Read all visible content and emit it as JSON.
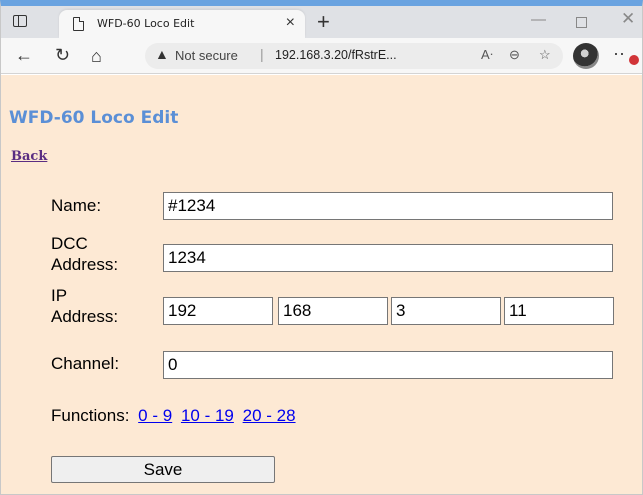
{
  "browser": {
    "tab_title": "WFD-60 Loco Edit",
    "tab_close": "×",
    "new_tab": "+",
    "security_label": "Not secure",
    "url": "192.168.3.20/fRstrE...",
    "window_min": "—",
    "window_close": "✕"
  },
  "page": {
    "title": "WFD-60 Loco Edit",
    "back_link": "Back",
    "name_label": "Name:",
    "name_value": "#1234",
    "dcc_label_line1": "DCC",
    "dcc_label_line2": "Address:",
    "dcc_value": "1234",
    "ip_label_line1": "IP",
    "ip_label_line2": "Address:",
    "ip_octets": [
      "192",
      "168",
      "3",
      "11"
    ],
    "channel_label": "Channel:",
    "channel_value": "0",
    "functions_label": "Functions:",
    "function_links": [
      "0 - 9",
      "10 - 19",
      "20 - 28"
    ],
    "save_label": "Save"
  },
  "colors": {
    "page_bg": "#fde9d4",
    "title": "#5b8fd6",
    "back_link": "#5a2d82",
    "links": "#0000ee"
  }
}
